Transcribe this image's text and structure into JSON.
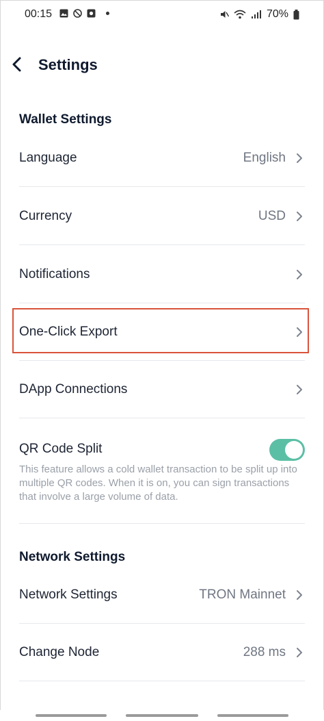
{
  "status_bar": {
    "time": "00:15",
    "battery": "70%",
    "icons_left": [
      "image-icon",
      "blocked-icon",
      "camera-icon",
      "dot-icon"
    ],
    "icons_right": [
      "mute-icon",
      "wifi-icon",
      "signal-icon",
      "battery-icon"
    ]
  },
  "header": {
    "title": "Settings",
    "back_icon": "back-chevron-icon"
  },
  "wallet_section": {
    "title": "Wallet Settings",
    "items": [
      {
        "label": "Language",
        "value": "English"
      },
      {
        "label": "Currency",
        "value": "USD"
      },
      {
        "label": "Notifications",
        "value": ""
      },
      {
        "label": "One-Click Export",
        "value": "",
        "highlighted": true
      },
      {
        "label": "DApp Connections",
        "value": ""
      }
    ],
    "qr_split": {
      "label": "QR Code Split",
      "description": "This feature allows a cold wallet transaction to be split up into multiple QR codes. When it is on, you can sign transactions that involve a large volume of data.",
      "enabled": true
    }
  },
  "network_section": {
    "title": "Network Settings",
    "items": [
      {
        "label": "Network Settings",
        "value": "TRON Mainnet"
      },
      {
        "label": "Change Node",
        "value": "288 ms"
      }
    ]
  },
  "colors": {
    "accent_toggle": "#5bbfa5",
    "highlight_border": "#d9533a",
    "title": "#0f1a2e",
    "muted": "#6f7682"
  }
}
